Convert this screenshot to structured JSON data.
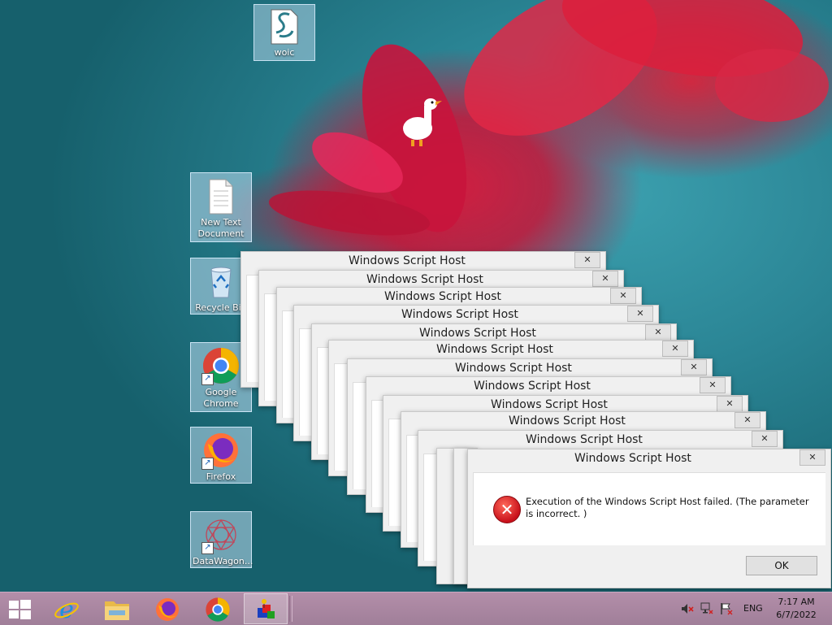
{
  "desktop": {
    "icons": [
      {
        "label": "woic"
      },
      {
        "label": "New Text Document"
      },
      {
        "label": "Recycle Bin"
      },
      {
        "label": "Google Chrome"
      },
      {
        "label": "Firefox"
      },
      {
        "label": "DataWagon..."
      }
    ]
  },
  "dialogs": {
    "title": "Windows Script Host",
    "close_symbol": "✕",
    "message": "Execution of the Windows Script Host failed. (The parameter is incorrect. )",
    "ok_label": "OK",
    "error_symbol": "✕"
  },
  "taskbar": {
    "apps": [
      {
        "icon": "internet-explorer-icon"
      },
      {
        "icon": "file-explorer-icon"
      },
      {
        "icon": "firefox-icon"
      },
      {
        "icon": "chrome-icon"
      },
      {
        "icon": "script-app-icon"
      }
    ],
    "language": "ENG",
    "time": "7:17 AM",
    "date": "6/7/2022"
  },
  "colors": {
    "taskbar": "#a8879f",
    "wallpaper_teal": "#2a8494",
    "flower_red": "#d7193c",
    "error_red": "#c8101a"
  }
}
